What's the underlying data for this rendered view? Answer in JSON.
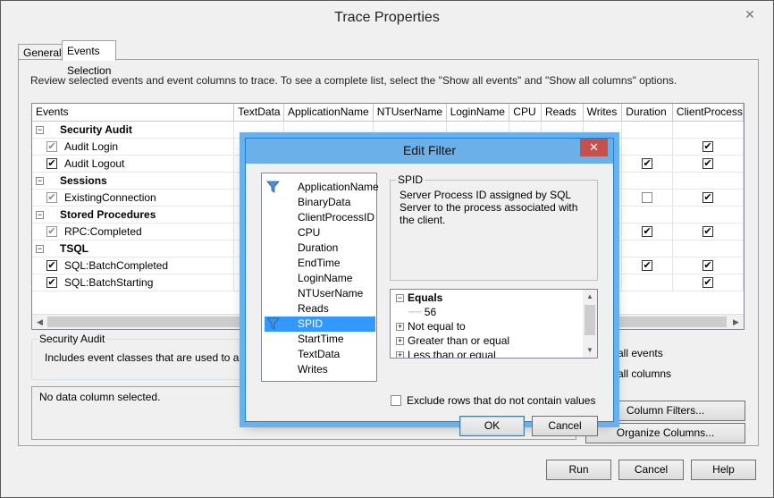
{
  "window": {
    "title": "Trace Properties",
    "close_glyph": "✕"
  },
  "tabs": [
    {
      "label": "General",
      "active": false
    },
    {
      "label": "Events Selection",
      "active": true
    }
  ],
  "instructions": "Review selected events and event columns to trace. To see a complete list, select the \"Show all events\" and \"Show all columns\" options.",
  "grid": {
    "columns": [
      "Events",
      "TextData",
      "ApplicationName",
      "NTUserName",
      "LoginName",
      "CPU",
      "Reads",
      "Writes",
      "Duration",
      "ClientProcess"
    ],
    "rows": [
      {
        "type": "category",
        "label": "Security Audit"
      },
      {
        "type": "event",
        "label": "Audit Login",
        "check": "gray",
        "duration": "",
        "client": "checked"
      },
      {
        "type": "event",
        "label": "Audit Logout",
        "check": "checked",
        "duration": "checked",
        "client": "checked"
      },
      {
        "type": "category",
        "label": "Sessions"
      },
      {
        "type": "event",
        "label": "ExistingConnection",
        "check": "gray",
        "duration": "empty",
        "client": "checked"
      },
      {
        "type": "category",
        "label": "Stored Procedures"
      },
      {
        "type": "event",
        "label": "RPC:Completed",
        "check": "gray",
        "duration": "checked",
        "client": "checked"
      },
      {
        "type": "category",
        "label": "TSQL"
      },
      {
        "type": "event",
        "label": "SQL:BatchCompleted",
        "check": "checked",
        "duration": "checked",
        "client": "checked"
      },
      {
        "type": "event",
        "label": "SQL:BatchStarting",
        "check": "checked",
        "duration": "",
        "client": "checked"
      }
    ]
  },
  "security_audit_box": {
    "legend": "Security Audit",
    "description": "Includes event classes that are used to audit se"
  },
  "no_data": "No data column selected.",
  "options": {
    "show_all_events_partial": "w all events",
    "show_all_columns_partial": "w all columns"
  },
  "buttons": {
    "column_filters": "Column Filters...",
    "organize_columns": "Organize Columns...",
    "run": "Run",
    "cancel": "Cancel",
    "help": "Help"
  },
  "edit_filter": {
    "title": "Edit Filter",
    "columns": [
      "ApplicationName",
      "BinaryData",
      "ClientProcessID",
      "CPU",
      "Duration",
      "EndTime",
      "LoginName",
      "NTUserName",
      "Reads",
      "SPID",
      "StartTime",
      "TextData",
      "Writes"
    ],
    "filtered_columns": [
      "ApplicationName",
      "SPID"
    ],
    "selected_column": "SPID",
    "group_legend": "SPID",
    "group_description": "Server Process ID assigned by SQL Server to the process associated with the client.",
    "tree": [
      {
        "label": "Equals",
        "expanded": true,
        "bold": true
      },
      {
        "label": "56",
        "child": true
      },
      {
        "label": "Not equal to",
        "expanded": false
      },
      {
        "label": "Greater than or equal",
        "expanded": false
      },
      {
        "label": "Less than or equal",
        "expanded": false
      }
    ],
    "exclude_label": "Exclude rows that do not contain values",
    "ok_label": "OK",
    "cancel_label": "Cancel"
  }
}
